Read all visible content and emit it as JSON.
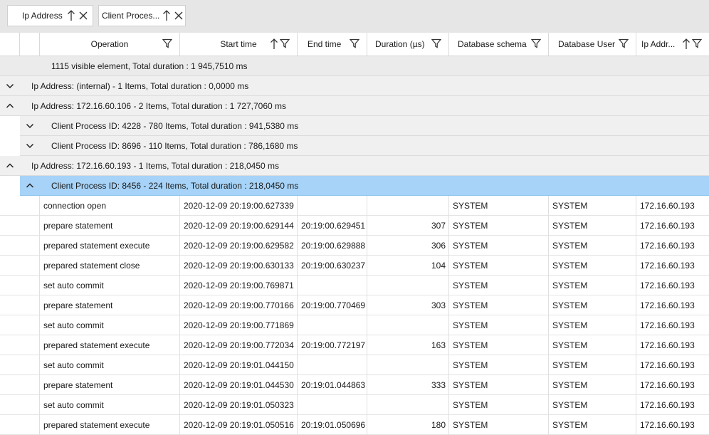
{
  "group_panel": {
    "chips": [
      {
        "label": "Ip Address"
      },
      {
        "label": "Client  Proces..."
      }
    ]
  },
  "columns": [
    {
      "label": "Operation",
      "sort": "none"
    },
    {
      "label": "Start time",
      "sort": "ascending"
    },
    {
      "label": "End time",
      "sort": "none"
    },
    {
      "label": "Duration (µs)",
      "sort": "none"
    },
    {
      "label": "Database schema",
      "sort": "none"
    },
    {
      "label": "Database User",
      "sort": "none"
    },
    {
      "label": "Ip Addr...",
      "sort": "ascending"
    }
  ],
  "summary": "1115 visible element, Total duration : 1 945,7510 ms",
  "groups": [
    {
      "level": 1,
      "state": "collapsed",
      "label": "Ip Address: (internal) - 1 Items, Total duration : 0,0000 ms"
    },
    {
      "level": 1,
      "state": "expanded",
      "label": "Ip Address: 172.16.60.106 - 2 Items, Total duration : 1 727,7060 ms"
    },
    {
      "level": 2,
      "state": "collapsed",
      "label": "Client Process ID: 4228 - 780 Items, Total duration : 941,5380 ms"
    },
    {
      "level": 2,
      "state": "collapsed",
      "label": "Client Process ID: 8696 - 110 Items, Total duration : 786,1680 ms"
    },
    {
      "level": 1,
      "state": "expanded",
      "label": "Ip Address: 172.16.60.193 - 1 Items, Total duration : 218,0450 ms"
    },
    {
      "level": 2,
      "state": "expanded",
      "selected": true,
      "label": "Client Process ID: 8456 - 224 Items, Total duration : 218,0450 ms"
    }
  ],
  "rows": [
    {
      "operation": "connection open",
      "start": "2020-12-09 20:19:00.627339",
      "end": "",
      "duration": "",
      "schema": "SYSTEM",
      "user": "SYSTEM",
      "ip": "172.16.60.193"
    },
    {
      "operation": "prepare statement",
      "start": "2020-12-09 20:19:00.629144",
      "end": "20:19:00.629451",
      "duration": "307",
      "schema": "SYSTEM",
      "user": "SYSTEM",
      "ip": "172.16.60.193"
    },
    {
      "operation": "prepared statement execute",
      "start": "2020-12-09 20:19:00.629582",
      "end": "20:19:00.629888",
      "duration": "306",
      "schema": "SYSTEM",
      "user": "SYSTEM",
      "ip": "172.16.60.193"
    },
    {
      "operation": "prepared statement close",
      "start": "2020-12-09 20:19:00.630133",
      "end": "20:19:00.630237",
      "duration": "104",
      "schema": "SYSTEM",
      "user": "SYSTEM",
      "ip": "172.16.60.193"
    },
    {
      "operation": "set auto commit",
      "start": "2020-12-09 20:19:00.769871",
      "end": "",
      "duration": "",
      "schema": "SYSTEM",
      "user": "SYSTEM",
      "ip": "172.16.60.193"
    },
    {
      "operation": "prepare statement",
      "start": "2020-12-09 20:19:00.770166",
      "end": "20:19:00.770469",
      "duration": "303",
      "schema": "SYSTEM",
      "user": "SYSTEM",
      "ip": "172.16.60.193"
    },
    {
      "operation": "set auto commit",
      "start": "2020-12-09 20:19:00.771869",
      "end": "",
      "duration": "",
      "schema": "SYSTEM",
      "user": "SYSTEM",
      "ip": "172.16.60.193"
    },
    {
      "operation": "prepared statement execute",
      "start": "2020-12-09 20:19:00.772034",
      "end": "20:19:00.772197",
      "duration": "163",
      "schema": "SYSTEM",
      "user": "SYSTEM",
      "ip": "172.16.60.193"
    },
    {
      "operation": "set auto commit",
      "start": "2020-12-09 20:19:01.044150",
      "end": "",
      "duration": "",
      "schema": "SYSTEM",
      "user": "SYSTEM",
      "ip": "172.16.60.193"
    },
    {
      "operation": "prepare statement",
      "start": "2020-12-09 20:19:01.044530",
      "end": "20:19:01.044863",
      "duration": "333",
      "schema": "SYSTEM",
      "user": "SYSTEM",
      "ip": "172.16.60.193"
    },
    {
      "operation": "set auto commit",
      "start": "2020-12-09 20:19:01.050323",
      "end": "",
      "duration": "",
      "schema": "SYSTEM",
      "user": "SYSTEM",
      "ip": "172.16.60.193"
    },
    {
      "operation": "prepared statement execute",
      "start": "2020-12-09 20:19:01.050516",
      "end": "20:19:01.050696",
      "duration": "180",
      "schema": "SYSTEM",
      "user": "SYSTEM",
      "ip": "172.16.60.193"
    }
  ]
}
